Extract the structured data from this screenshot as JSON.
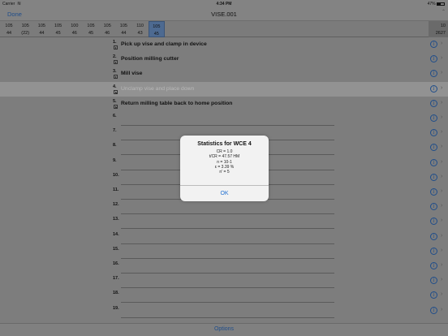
{
  "status_bar": {
    "carrier": "Carrier",
    "wifi_icon": "wifi-icon",
    "time": "4:34 PM",
    "battery": "47%"
  },
  "nav": {
    "done_label": "Done",
    "title": "VISE.001",
    "chevron_icon": "chevron-up-icon"
  },
  "header_columns": [
    {
      "top": "105",
      "bottom": "44"
    },
    {
      "top": "105",
      "bottom": "(22)"
    },
    {
      "top": "105",
      "bottom": "44"
    },
    {
      "top": "105",
      "bottom": "45"
    },
    {
      "top": "100",
      "bottom": "46"
    },
    {
      "top": "105",
      "bottom": "45"
    },
    {
      "top": "105",
      "bottom": "46"
    },
    {
      "top": "105",
      "bottom": "44"
    },
    {
      "top": "110",
      "bottom": "43"
    },
    {
      "top": "105",
      "bottom": "45",
      "selected": true
    }
  ],
  "header_right": {
    "top": "10",
    "bottom": "2627"
  },
  "rows": [
    {
      "num": "1.",
      "text": "Pick up vise and clamp in device",
      "check": true
    },
    {
      "num": "2.",
      "text": "Position milling cutter",
      "check": true
    },
    {
      "num": "3.",
      "text": "Mill vise",
      "check": true
    },
    {
      "num": "4.",
      "text": "Unclamp vise and place down",
      "check": true,
      "highlight": true
    },
    {
      "num": "5.",
      "text": "Return milling table back to home position",
      "check": true
    },
    {
      "num": "6.",
      "text": ""
    },
    {
      "num": "7.",
      "text": ""
    },
    {
      "num": "8.",
      "text": ""
    },
    {
      "num": "9.",
      "text": ""
    },
    {
      "num": "10.",
      "text": ""
    },
    {
      "num": "11.",
      "text": ""
    },
    {
      "num": "12.",
      "text": ""
    },
    {
      "num": "13.",
      "text": ""
    },
    {
      "num": "14.",
      "text": ""
    },
    {
      "num": "15.",
      "text": ""
    },
    {
      "num": "16.",
      "text": ""
    },
    {
      "num": "17.",
      "text": ""
    },
    {
      "num": "18.",
      "text": ""
    },
    {
      "num": "19.",
      "text": ""
    }
  ],
  "row_icons": {
    "info": "info-icon",
    "chevron": "chevron-right-icon",
    "checkbox": "checkbox-icon"
  },
  "alert": {
    "title": "Statistics for WCE 4",
    "lines": [
      "CR = 1.0",
      "t/CR = 47.57 HM",
      "n = 10-1",
      "ε = 3.39 %",
      "n' = 5"
    ],
    "ok_label": "OK"
  },
  "bottom": {
    "options_label": "Options"
  },
  "colors": {
    "accent": "#1f4d8a",
    "selected_column": "#4d6a91",
    "alert_button": "#1f6fd1"
  }
}
